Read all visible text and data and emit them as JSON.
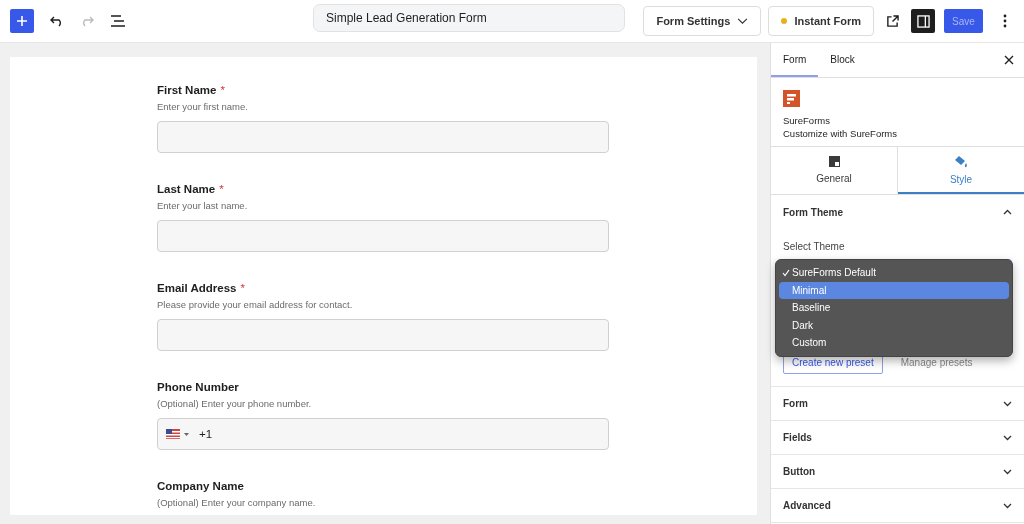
{
  "toolbar": {
    "document_title": "Simple Lead Generation Form",
    "form_settings": "Form Settings",
    "instant_form": "Instant Form",
    "save": "Save",
    "undo_disabled": false,
    "redo_disabled": true,
    "sidebar_toggle_on": true
  },
  "form": {
    "fields": [
      {
        "kind": "text",
        "label": "First Name",
        "required_mark": "*",
        "help": "Enter your first name."
      },
      {
        "kind": "text",
        "label": "Last Name",
        "required_mark": "*",
        "help": "Enter your last name."
      },
      {
        "kind": "text",
        "label": "Email Address",
        "required_mark": "*",
        "help": "Please provide your email address for contact."
      },
      {
        "kind": "phone",
        "label": "Phone Number",
        "help": "(Optional) Enter your phone number.",
        "value": "+1"
      },
      {
        "kind": "label-only",
        "label": "Company Name",
        "help": "(Optional) Enter your company name."
      }
    ]
  },
  "sidebar": {
    "tabs": [
      {
        "label": "Form",
        "selected": true
      },
      {
        "label": "Block",
        "selected": false
      }
    ],
    "plugin": {
      "name": "SureForms",
      "description": "Customize with SureForms"
    },
    "panel_tabs": [
      {
        "label": "General",
        "selected": false
      },
      {
        "label": "Style",
        "selected": true
      }
    ],
    "theme_section": {
      "title": "Form Theme",
      "expanded": true,
      "select_label": "Select Theme",
      "options": [
        {
          "label": "SureForms Default",
          "checked": true,
          "highlighted": false
        },
        {
          "label": "Minimal",
          "checked": false,
          "highlighted": true
        },
        {
          "label": "Baseline",
          "checked": false,
          "highlighted": false
        },
        {
          "label": "Dark",
          "checked": false,
          "highlighted": false
        },
        {
          "label": "Custom",
          "checked": false,
          "highlighted": false
        }
      ],
      "create_preset": "Create new preset",
      "manage_presets": "Manage presets"
    },
    "sections": [
      {
        "title": "Form",
        "expanded": false
      },
      {
        "title": "Fields",
        "expanded": false
      },
      {
        "title": "Button",
        "expanded": false
      },
      {
        "title": "Advanced",
        "expanded": false
      }
    ]
  }
}
